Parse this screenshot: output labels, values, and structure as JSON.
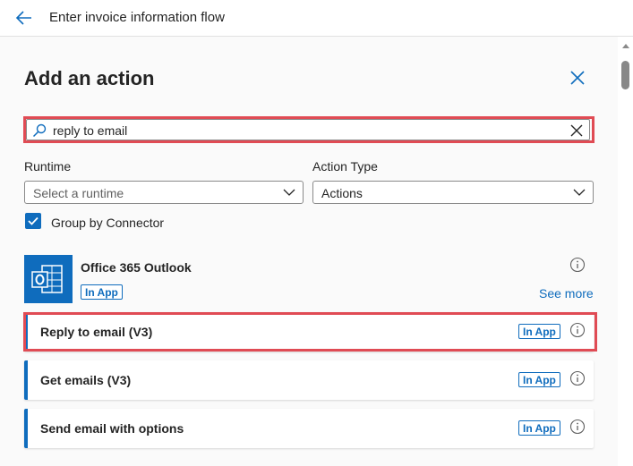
{
  "topbar": {
    "title": "Enter invoice information flow"
  },
  "panel": {
    "title": "Add an action"
  },
  "search": {
    "value": "reply to email"
  },
  "filters": {
    "runtime_label": "Runtime",
    "runtime_value": "Select a runtime",
    "action_type_label": "Action Type",
    "action_type_value": "Actions"
  },
  "group_by": {
    "label": "Group by Connector",
    "checked": true
  },
  "connector": {
    "name": "Office 365 Outlook",
    "badge": "In App",
    "see_more": "See more"
  },
  "actions": [
    {
      "label": "Reply to email (V3)",
      "badge": "In App"
    },
    {
      "label": "Get emails (V3)",
      "badge": "In App"
    },
    {
      "label": "Send email with options",
      "badge": "In App"
    }
  ],
  "colors": {
    "accent": "#0f6cbd",
    "highlight": "#e04b54"
  }
}
